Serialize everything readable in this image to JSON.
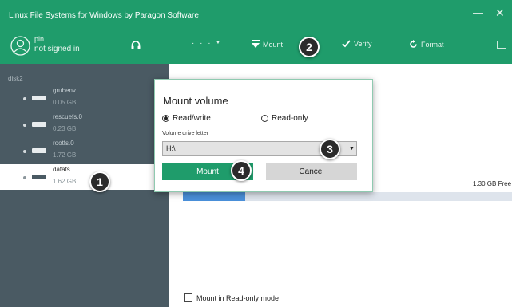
{
  "window": {
    "title": "Linux File Systems for Windows by Paragon Software",
    "minimize_glyph": "—",
    "close_glyph": "✕"
  },
  "toolbar": {
    "user_name": "pln",
    "user_status": "not signed in",
    "more_label": "· · ·",
    "more_caret": "▼",
    "mount_label": "Mount",
    "verify_label": "Verify",
    "format_label": "Format",
    "icons": [
      "user-avatar-icon",
      "headset-icon",
      "mount-arrow-icon",
      "checkmark-icon",
      "refresh-icon",
      "panel-icon"
    ]
  },
  "sidebar": {
    "disk_label": "disk2",
    "volumes": [
      {
        "name": "grubenv",
        "size": "0.05 GB",
        "selected": false
      },
      {
        "name": "rescuefs.0",
        "size": "0.23 GB",
        "selected": false
      },
      {
        "name": "rootfs.0",
        "size": "1.72 GB",
        "selected": false
      },
      {
        "name": "datafs",
        "size": "1.62 GB",
        "selected": true
      }
    ]
  },
  "main": {
    "free_label": "1.30 GB Free",
    "used_fraction": 0.19,
    "readonly_checkbox_label": "Mount in Read-only mode",
    "readonly_checked": false
  },
  "dialog": {
    "title": "Mount volume",
    "read_write_label": "Read/write",
    "read_only_label": "Read-only",
    "selected_mode": "read_write",
    "drive_letter_label": "Volume drive letter",
    "drive_letter_value": "H:\\",
    "dropdown_caret": "▼",
    "mount_button": "Mount",
    "cancel_button": "Cancel"
  },
  "callouts": [
    "1",
    "2",
    "3",
    "4"
  ],
  "colors": {
    "brand_green": "#1f9c6b",
    "sidebar": "#4a5a63",
    "usage_fill": "#4a8fd9",
    "usage_track": "#dee4ec"
  }
}
